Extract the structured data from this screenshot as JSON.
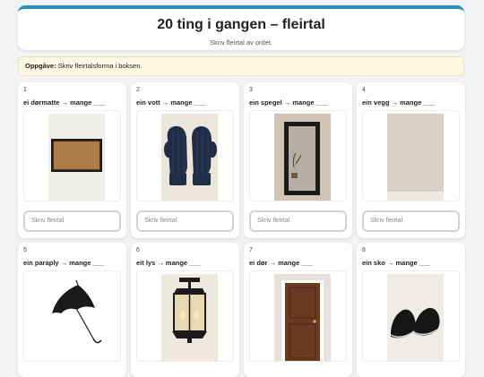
{
  "header": {
    "title": "20 ting i gangen – fleirtal",
    "subtitle": "Skriv fleirtal av ordet."
  },
  "task": {
    "label": "Oppgåve:",
    "text": "Skriv fleirtalsforma i boksen."
  },
  "cards": [
    {
      "num": "1",
      "prompt": "ei dørmatte → mange ___",
      "placeholder": "Skriv fleirtal",
      "icon": "doormat-image"
    },
    {
      "num": "2",
      "prompt": "ein vott → mange ___",
      "placeholder": "Skriv fleirtal",
      "icon": "mittens-image"
    },
    {
      "num": "3",
      "prompt": "ein spegel → mange ___",
      "placeholder": "Skriv fleirtal",
      "icon": "mirror-image"
    },
    {
      "num": "4",
      "prompt": "ein vegg → mange ___",
      "placeholder": "Skriv fleirtal",
      "icon": "wall-image"
    },
    {
      "num": "5",
      "prompt": "ein paraply → mange ___",
      "placeholder": "",
      "icon": "umbrella-image"
    },
    {
      "num": "6",
      "prompt": "eit lys → mange ___",
      "placeholder": "",
      "icon": "ceiling-lamp-image"
    },
    {
      "num": "7",
      "prompt": "ei dør → mange ___",
      "placeholder": "",
      "icon": "door-image"
    },
    {
      "num": "8",
      "prompt": "ein sko → mange ___",
      "placeholder": "",
      "icon": "sneakers-image"
    }
  ]
}
